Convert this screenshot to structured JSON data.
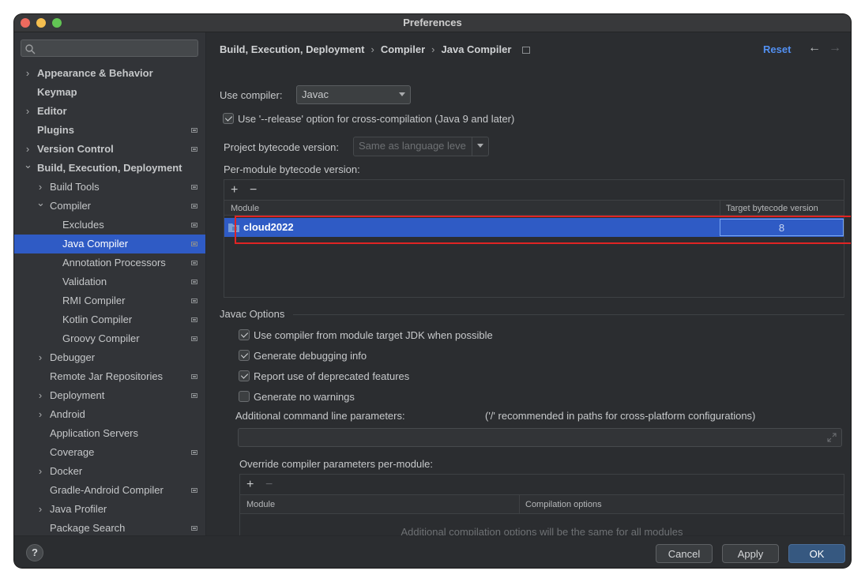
{
  "window": {
    "title": "Preferences"
  },
  "traffic_lights": {
    "close": "#ed6a5e",
    "minimize": "#f5bf4f",
    "maximize": "#62c554"
  },
  "sidebar": {
    "search_placeholder": "",
    "items": [
      {
        "label": "Appearance & Behavior",
        "expandable": true,
        "bold": true
      },
      {
        "label": "Keymap",
        "expandable": false,
        "bold": true
      },
      {
        "label": "Editor",
        "expandable": true,
        "bold": true
      },
      {
        "label": "Plugins",
        "expandable": false,
        "bold": true
      },
      {
        "label": "Version Control",
        "expandable": true,
        "bold": true
      },
      {
        "label": "Build, Execution, Deployment",
        "expandable": true,
        "bold": true
      },
      {
        "label": "Build Tools",
        "expandable": true
      },
      {
        "label": "Compiler",
        "expandable": true
      },
      {
        "label": "Excludes"
      },
      {
        "label": "Java Compiler",
        "selected": true
      },
      {
        "label": "Annotation Processors"
      },
      {
        "label": "Validation"
      },
      {
        "label": "RMI Compiler"
      },
      {
        "label": "Kotlin Compiler"
      },
      {
        "label": "Groovy Compiler"
      },
      {
        "label": "Debugger",
        "expandable": true
      },
      {
        "label": "Remote Jar Repositories"
      },
      {
        "label": "Deployment",
        "expandable": true
      },
      {
        "label": "Android",
        "expandable": true
      },
      {
        "label": "Application Servers"
      },
      {
        "label": "Coverage"
      },
      {
        "label": "Docker",
        "expandable": true
      },
      {
        "label": "Gradle-Android Compiler"
      },
      {
        "label": "Java Profiler",
        "expandable": true
      },
      {
        "label": "Package Search"
      }
    ]
  },
  "header": {
    "breadcrumb": [
      "Build, Execution, Deployment",
      "Compiler",
      "Java Compiler"
    ],
    "separator": "›",
    "reset_label": "Reset",
    "back_glyph": "←",
    "forward_glyph": "→"
  },
  "main": {
    "use_compiler_label": "Use compiler:",
    "use_compiler_value": "Javac",
    "release_option_label": "Use '--release' option for cross-compilation (Java 9 and later)",
    "release_option_checked": true,
    "project_bytecode_label": "Project bytecode version:",
    "project_bytecode_placeholder": "Same as language leve",
    "per_module_label": "Per-module bytecode version:",
    "add_glyph": "+",
    "remove_glyph": "−",
    "module_table": {
      "columns": [
        "Module",
        "Target bytecode version"
      ],
      "rows": [
        {
          "module": "cloud2022",
          "target": "8"
        }
      ]
    },
    "javac_options_title": "Javac Options",
    "javac_options": [
      {
        "label": "Use compiler from module target JDK when possible",
        "checked": true
      },
      {
        "label": "Generate debugging info",
        "checked": true
      },
      {
        "label": "Report use of deprecated features",
        "checked": true
      },
      {
        "label": "Generate no warnings",
        "checked": false
      }
    ],
    "additional_params_label": "Additional command line parameters:",
    "additional_params_hint": "('/' recommended in paths for cross-platform configurations)",
    "additional_params_value": "",
    "override_label": "Override compiler parameters per-module:",
    "override_table": {
      "columns": [
        "Module",
        "Compilation options"
      ],
      "empty_text": "Additional compilation options will be the same for all modules"
    }
  },
  "footer": {
    "help_label": "?",
    "cancel_label": "Cancel",
    "apply_label": "Apply",
    "ok_label": "OK"
  },
  "colors": {
    "selection": "#2f5bc5",
    "accent_link": "#5290f2",
    "highlight_box": "#e02424"
  }
}
